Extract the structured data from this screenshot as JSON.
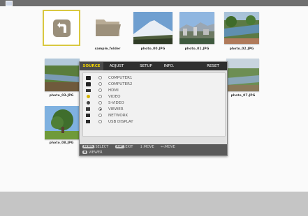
{
  "viewer": {
    "thumbnails": [
      {
        "name": "back",
        "caption": ""
      },
      {
        "name": "folder",
        "caption": "sample_folder"
      },
      {
        "name": "photo_00",
        "caption": "photo_00.JPG"
      },
      {
        "name": "photo_01",
        "caption": "photo_01.JPG"
      },
      {
        "name": "photo_02",
        "caption": "photo_02.JPG"
      },
      {
        "name": "photo_03",
        "caption": "photo_03.JPG"
      },
      {
        "name": "photo_07",
        "caption": "photo_07.JPG"
      },
      {
        "name": "photo_08",
        "caption": "photo_08.JPG"
      }
    ]
  },
  "osd": {
    "tabs": [
      "SOURCE",
      "ADJUST",
      "SETUP",
      "INFO.",
      "RESET"
    ],
    "active_tab": "SOURCE",
    "sources": [
      {
        "label": "COMPUTER1",
        "selected": false
      },
      {
        "label": "COMPUTER2",
        "selected": false
      },
      {
        "label": "HDMI",
        "selected": false
      },
      {
        "label": "VIDEO",
        "selected": false
      },
      {
        "label": "S-VIDEO",
        "selected": false
      },
      {
        "label": "VIEWER",
        "selected": true
      },
      {
        "label": "NETWORK",
        "selected": false
      },
      {
        "label": "USB DISPLAY",
        "selected": false
      }
    ],
    "help": {
      "enter_key": "ENTER",
      "select": ":SELECT",
      "exit_key": "EXIT",
      "exit": ":EXIT",
      "move_updown": "↕:MOVE",
      "move_leftright": "↔:MOVE",
      "current_source": "VIEWER"
    }
  },
  "colors": {
    "accent": "#f2d300",
    "tab_bar": "#2f2f2f",
    "help_bar": "#5a5a5a",
    "focus_border": "#d9c841"
  }
}
